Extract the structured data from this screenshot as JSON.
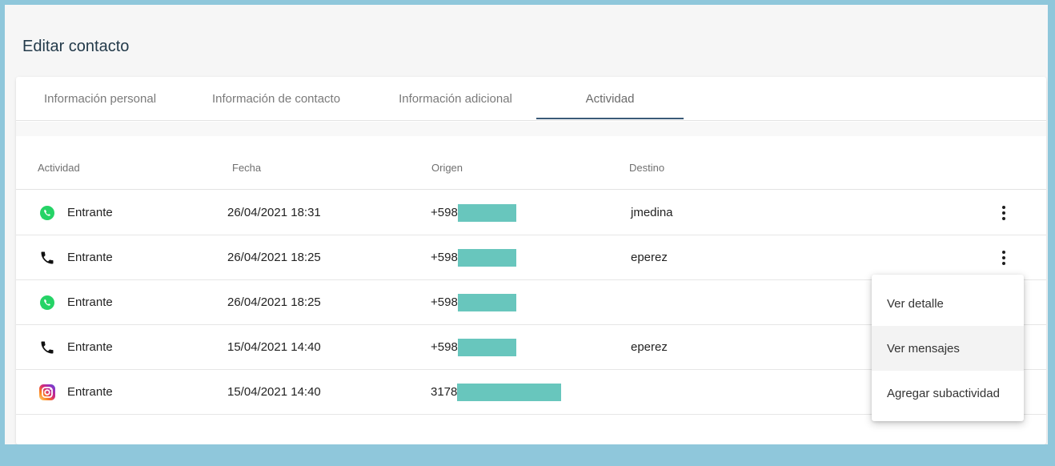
{
  "page": {
    "title": "Editar contacto"
  },
  "tabs": [
    {
      "label": "Información personal"
    },
    {
      "label": "Información de contacto"
    },
    {
      "label": "Información adicional"
    },
    {
      "label": "Actividad",
      "active": true
    }
  ],
  "table": {
    "headers": [
      "Actividad",
      "Fecha",
      "Origen",
      "Destino"
    ],
    "rows": [
      {
        "icon": "whatsapp-icon",
        "actividad": "Entrante",
        "fecha": "26/04/2021 18:31",
        "origen": "+598",
        "destino": "jmedina",
        "has_menu": true
      },
      {
        "icon": "phone-icon",
        "actividad": "Entrante",
        "fecha": "26/04/2021 18:25",
        "origen": "+598",
        "destino": "eperez",
        "has_menu": true
      },
      {
        "icon": "whatsapp-icon",
        "actividad": "Entrante",
        "fecha": "26/04/2021 18:25",
        "origen": "+598",
        "destino": "",
        "has_menu": false
      },
      {
        "icon": "phone-icon",
        "actividad": "Entrante",
        "fecha": "15/04/2021 14:40",
        "origen": "+598",
        "destino": "eperez",
        "has_menu": false
      },
      {
        "icon": "instagram-icon",
        "actividad": "Entrante",
        "fecha": "15/04/2021 14:40",
        "origen": "3178",
        "destino": "",
        "has_menu": false
      }
    ]
  },
  "context_menu": {
    "items": [
      {
        "label": "Ver detalle"
      },
      {
        "label": "Ver mensajes",
        "hover": true
      },
      {
        "label": "Agregar subactividad"
      }
    ]
  },
  "colors": {
    "frame": "#8fc7db",
    "tab_indicator": "#3b5b78",
    "redaction": "#68c6bd",
    "whatsapp": "#25d366"
  }
}
